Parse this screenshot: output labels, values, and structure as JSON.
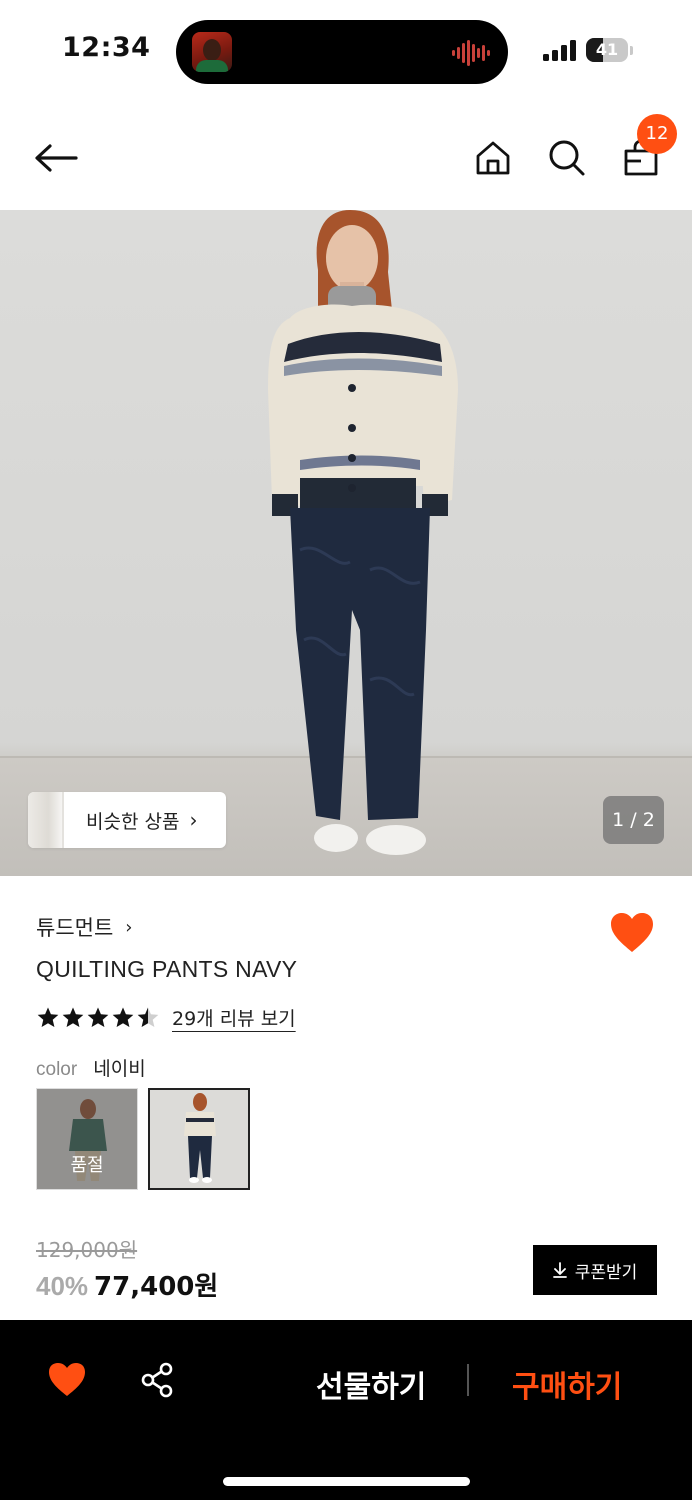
{
  "status_bar": {
    "time": "12:34",
    "battery_level": "41",
    "battery_fraction": 0.41,
    "signal_icon": "cellular-signal-icon",
    "live_activity_icon": "audio-waveform-icon"
  },
  "nav": {
    "back_icon": "arrow-left-icon",
    "home_icon": "home-icon",
    "search_icon": "search-icon",
    "cart_icon": "shopping-bag-icon",
    "cart_count": "12"
  },
  "hero": {
    "similar_button_label": "비슷한 상품",
    "page_indicator": "1 / 2"
  },
  "product": {
    "brand": "튜드먼트",
    "name": "QUILTING PANTS NAVY",
    "rating": 4.5,
    "review_link": "29개 리뷰 보기",
    "color_label": "color",
    "color_value": "네이비",
    "swatches": [
      {
        "name": "green-sweater-outfit",
        "soldout_label": "품절"
      },
      {
        "name": "navy-quilting-pants-outfit"
      }
    ],
    "original_price": "129,000원",
    "discount": "40%",
    "sale_price": "77,400원",
    "coupon_button": "쿠폰받기"
  },
  "bottom_bar": {
    "gift_button": "선물하기",
    "buy_button": "구매하기"
  },
  "colors": {
    "accent": "#ff4f12",
    "black": "#000000"
  }
}
